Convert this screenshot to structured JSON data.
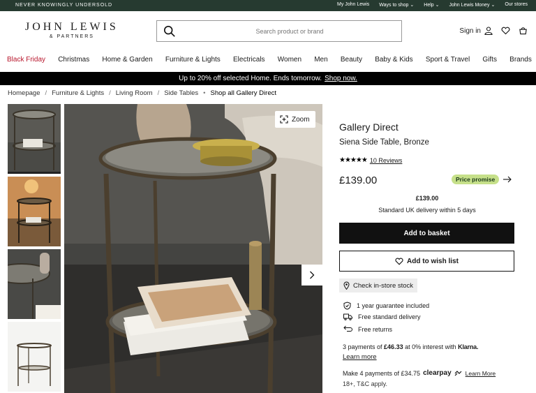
{
  "topbar": {
    "tagline": "NEVER KNOWINGLY UNDERSOLD",
    "links": [
      "My John Lewis",
      "Ways to shop",
      "Help",
      "John Lewis Money",
      "Our stores"
    ]
  },
  "header": {
    "logo_line1": "JOHN LEWIS",
    "logo_line2": "& PARTNERS",
    "search_placeholder": "Search product or brand",
    "sign_in": "Sign in"
  },
  "nav": {
    "items": [
      "Black Friday",
      "Christmas",
      "Home & Garden",
      "Furniture & Lights",
      "Electricals",
      "Women",
      "Men",
      "Beauty",
      "Baby & Kids",
      "Sport & Travel",
      "Gifts",
      "Brands"
    ]
  },
  "promo": {
    "text": "Up to 20% off selected Home. Ends tomorrow.",
    "link": "Shop now."
  },
  "breadcrumb": {
    "items": [
      "Homepage",
      "Furniture & Lights",
      "Living Room",
      "Side Tables"
    ],
    "current": "Shop all Gallery Direct"
  },
  "gallery": {
    "zoom_label": "Zoom"
  },
  "product": {
    "brand": "Gallery Direct",
    "name": "Siena Side Table, Bronze",
    "rating_stars": 5,
    "reviews": "10 Reviews",
    "price": "£139.00",
    "price_promise": "Price promise",
    "delivery_price": "£139.00",
    "delivery_text": "Standard UK delivery within 5 days",
    "add_to_basket": "Add to basket",
    "add_to_wishlist": "Add to wish list",
    "check_stock": "Check in-store stock",
    "features": [
      "1 year guarantee included",
      "Free standard delivery",
      "Free returns"
    ],
    "klarna_pre": "3 payments of",
    "klarna_amount": "£46.33",
    "klarna_post": "at 0% interest with",
    "klarna_brand": "Klarna.",
    "klarna_learn": "Learn more",
    "clearpay_text": "Make 4 payments of £34.75",
    "clearpay_brand": "clearpay",
    "clearpay_learn": "Learn More",
    "terms": "18+, T&C apply."
  },
  "colors": {
    "topbar": "#263a30",
    "black_friday": "#b8172d",
    "price_promise": "#c6e08a"
  }
}
